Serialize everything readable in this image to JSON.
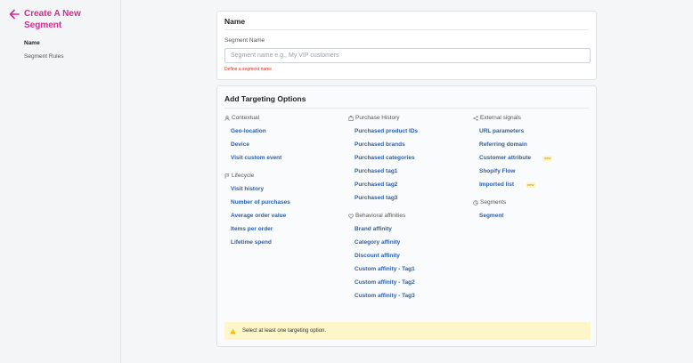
{
  "sidebar": {
    "title": "Create A New Segment",
    "items": [
      {
        "label": "Name",
        "active": true
      },
      {
        "label": "Segment Rules",
        "active": false
      }
    ]
  },
  "name_card": {
    "title": "Name",
    "field_label": "Segment Name",
    "placeholder": "Segment name e.g., My VIP customers",
    "value": "",
    "error": "Define a segment name"
  },
  "targeting_card": {
    "title": "Add Targeting Options",
    "groups": {
      "contextual": {
        "label": "Contextual",
        "icon": "person-icon",
        "options": [
          "Geo-location",
          "Device",
          "Visit custom event"
        ]
      },
      "lifecycle": {
        "label": "Lifecycle",
        "icon": "flag-icon",
        "options": [
          "Visit history",
          "Number of purchases",
          "Average order value",
          "Items per order",
          "Lifetime spend"
        ]
      },
      "purchase_history": {
        "label": "Purchase History",
        "icon": "bag-icon",
        "options": [
          "Purchased product IDs",
          "Purchased brands",
          "Purchased categories",
          "Purchased tag1",
          "Purchased tag2",
          "Purchased tag3"
        ]
      },
      "behavioral": {
        "label": "Behavioral affinities",
        "icon": "heart-icon",
        "options": [
          "Brand affinity",
          "Category affinity",
          "Discount affinity",
          "Custom affinity - Tag1",
          "Custom affinity - Tag2",
          "Custom affinity - Tag3"
        ]
      },
      "external": {
        "label": "External signals",
        "icon": "share-icon",
        "options": [
          "URL parameters",
          "Referring domain",
          "Customer attribute",
          "Shopify Flow",
          "Imported list"
        ]
      },
      "segments": {
        "label": "Segments",
        "icon": "segments-icon",
        "options": [
          "Segment"
        ]
      }
    },
    "new_badge": "new",
    "warning": "Select at least one targeting option."
  },
  "colors": {
    "accent": "#d12f8f",
    "link": "#2d5fa6",
    "error": "#d93025",
    "warning_bg": "#fdf6c8"
  }
}
